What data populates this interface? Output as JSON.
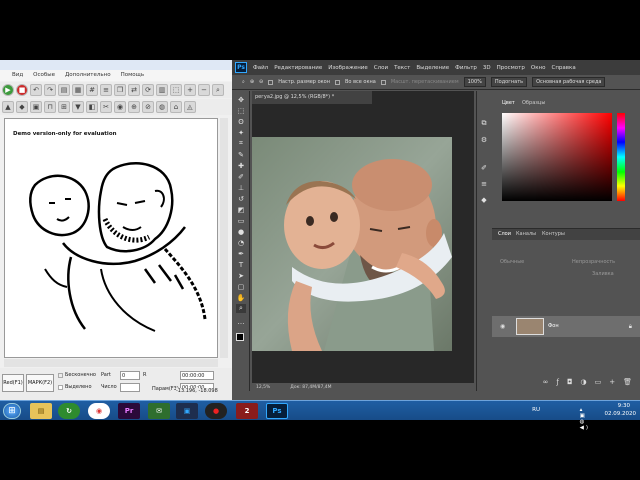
{
  "left_app": {
    "menu": [
      "",
      "Вид",
      "Особые",
      "Дополнительно",
      "Помощь"
    ],
    "demo_text": "Demo version-only for evaluation",
    "buttons": {
      "red": "Red(F1)",
      "mark": "МАРК(F2)"
    },
    "checkboxes": {
      "endless": "Бесконечно",
      "selected": "Выделено"
    },
    "labels": {
      "part": "Part",
      "number": "Число",
      "r": "R",
      "param": "Парам(F3)"
    },
    "fields": {
      "part": "0",
      "number": "",
      "t1": "00:00:00",
      "t2": "00:00:00",
      "t3": "00:00:00"
    },
    "coordinates": "-13.196, -18.098"
  },
  "photoshop": {
    "logo": "Ps",
    "menu": [
      "Файл",
      "Редактирование",
      "Изображение",
      "Слои",
      "Текст",
      "Выделение",
      "Фильтр",
      "3D",
      "Просмотр",
      "Окно",
      "Справка"
    ],
    "options": {
      "resize": "Настр. размер окон",
      "all_windows": "Во все окна",
      "scrubby": "Масшт. перетаскиванием",
      "zoom100": "100%",
      "fit": "Подогнать",
      "workspace": "Основная рабочая среда"
    },
    "doc_tab": "регуа2.jpg @ 12,5% (RGB/8*) *",
    "status": {
      "zoom": "12,5%",
      "doc": "Док: 87,4М/87,4М"
    },
    "panels": {
      "color": "Цвет",
      "swatches": "Образцы",
      "layers": "Слои",
      "channels": "Каналы",
      "paths": "Контуры",
      "kind": "Обычные",
      "opacity": "Непрозрачность",
      "fill": "Заливка",
      "layer_name": "Фон"
    }
  },
  "taskbar": {
    "lang": "RU",
    "time": "9:30",
    "date": "02.09.2020"
  }
}
